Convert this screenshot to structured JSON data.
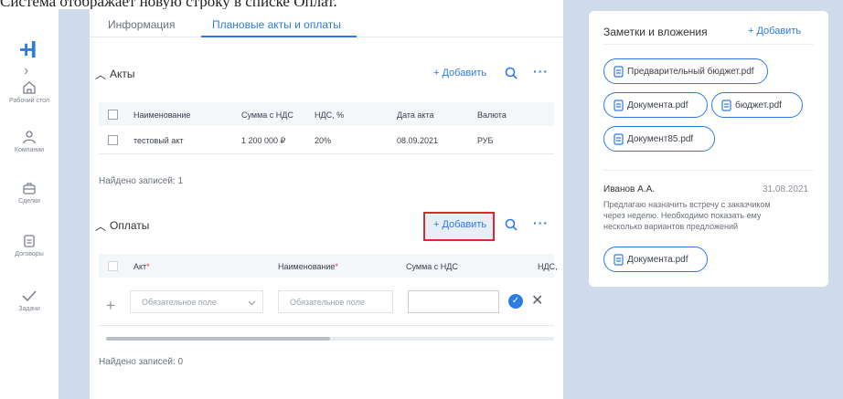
{
  "caption": "Система отображает новую строку в списке Оплат.",
  "sidebar": {
    "logo": "+I",
    "expand": "›",
    "items": [
      {
        "label": "Рабочий стол",
        "icon": "home-icon"
      },
      {
        "label": "Компании",
        "icon": "people-icon"
      },
      {
        "label": "Сделки",
        "icon": "briefcase-icon"
      },
      {
        "label": "Договоры",
        "icon": "document-icon"
      },
      {
        "label": "Задачи",
        "icon": "check-icon"
      }
    ]
  },
  "tabs": [
    {
      "label": "Информация",
      "active": false
    },
    {
      "label": "Плановые акты и оплаты",
      "active": true
    }
  ],
  "acts": {
    "title": "Акты",
    "add_label": "+ Добавить",
    "columns": [
      "Наименование",
      "Сумма с НДС",
      "НДС, %",
      "Дата акта",
      "Валюта"
    ],
    "rows": [
      [
        "тестовый акт",
        "1 200 000 ₽",
        "20%",
        "08.09.2021",
        "РУБ"
      ]
    ],
    "found": "Найдено записей: 1"
  },
  "payments": {
    "title": "Оплаты",
    "add_label": "+ Добавить",
    "columns": [
      "Акт",
      "Наименование",
      "Сумма с НДС",
      "НДС,"
    ],
    "required_mark": "*",
    "new_row": {
      "plus": "+",
      "act_placeholder": "Обязательное поле",
      "name_placeholder": "Обязательное поле",
      "amount_value": "",
      "confirm": "✓",
      "cancel": "✕"
    },
    "found": "Найдено записей: 0"
  },
  "notes": {
    "title": "Заметки и вложения",
    "add_label": "+ Добавить",
    "files": [
      "Предварительный бюджет.pdf",
      "Документа.pdf",
      "бюджет.pdf",
      "Документ85.pdf"
    ],
    "comment": {
      "author": "Иванов А.А.",
      "date": "31.08.2021",
      "text_lines": [
        "Предлагаю назначить встречу с заказчиком",
        "через неделю. Необходимо показать ему",
        "несколько вариантов предложений"
      ],
      "attachment": "Документа.pdf"
    }
  },
  "colors": {
    "accent": "#2d7be5",
    "highlight": "#d92b2b",
    "background": "#cfdaea"
  }
}
